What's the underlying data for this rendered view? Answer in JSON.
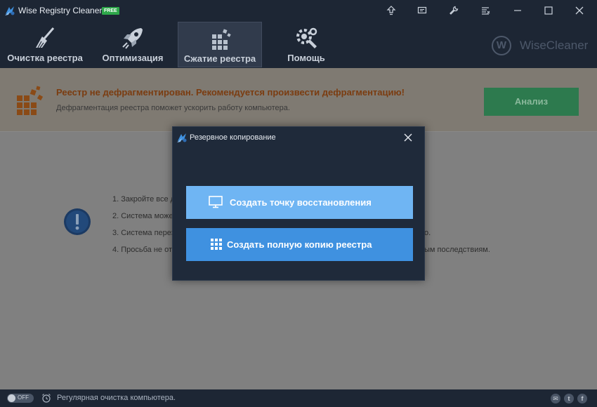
{
  "app": {
    "title": "Wise Registry Cleaner 9",
    "badge": "FREE"
  },
  "nav": {
    "items": [
      {
        "label": "Очистка реестра",
        "icon": "broom-icon"
      },
      {
        "label": "Оптимизация",
        "icon": "rocket-icon"
      },
      {
        "label": "Сжатие реестра",
        "icon": "blocks-icon",
        "active": true
      },
      {
        "label": "Помощь",
        "icon": "tools-icon"
      }
    ],
    "brand_letter": "W",
    "brand_text": "WiseCleaner"
  },
  "banner": {
    "title": "Реестр не дефрагментирован. Рекомендуется произвести дефрагментацию!",
    "subtitle": "Дефрагментация реестра поможет ускорить работу компьютера.",
    "analyze_label": "Анализ"
  },
  "steps": {
    "s1": "1. Закройте все д",
    "s2": "2. Система може",
    "s3": "3. Система перез",
    "s3_tail": "о.",
    "s4": "4. Просьба не от",
    "s4_tail": "ым последствиям."
  },
  "status": {
    "toggle_label": "OFF",
    "text": "Регулярная очистка компьютера."
  },
  "dialog": {
    "title": "Резервное копирование",
    "restore_label": "Создать точку восстановления",
    "full_label": "Создать полную копию реестра"
  },
  "colors": {
    "window_bg": "#1d2634",
    "dialog_bg": "#1f2a3a",
    "restore_button": "#6fb5f3",
    "full_button": "#3f91e0",
    "analyze_button": "#2d7a4e",
    "warning_text": "#7b3c10"
  }
}
